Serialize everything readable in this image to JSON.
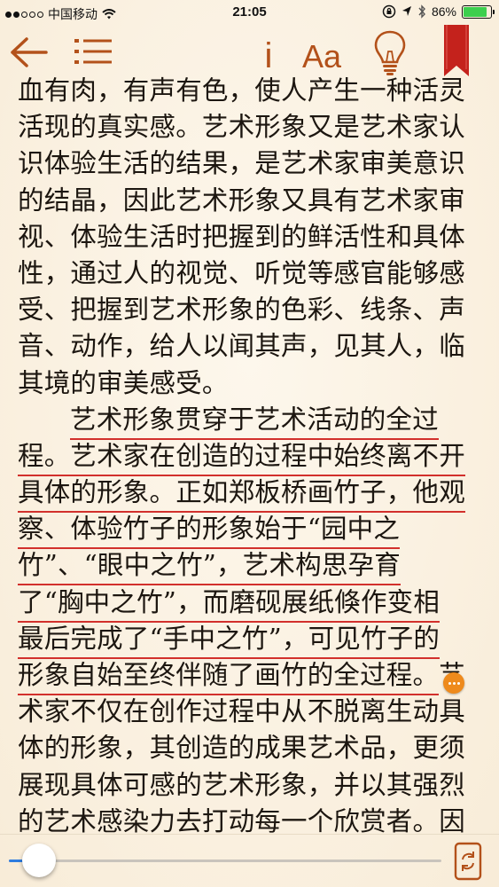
{
  "status_bar": {
    "carrier": "中国移动",
    "time": "21:05",
    "battery_text": "86%",
    "battery_level": 0.86,
    "icons": [
      "signal-icon",
      "wifi-icon",
      "rotation-lock-icon",
      "location-icon",
      "bluetooth-icon",
      "battery-icon"
    ]
  },
  "toolbar": {
    "icons": [
      "back-arrow-icon",
      "table-of-contents-icon",
      "info-icon",
      "font-size-icon",
      "lightbulb-icon",
      "bookmark-icon"
    ],
    "info_label": "i",
    "font_label": "Aa"
  },
  "colors": {
    "accent": "#b3511a",
    "bookmark": "#c4221c",
    "underline": "#d2302c",
    "page_bg": "#fbf3e4",
    "note_marker": "#ee8a1c",
    "slider_fill": "#2f7de0"
  },
  "content": {
    "p1": [
      "血有肉，有声有色，使人产生一种活灵",
      "活现的真实感。艺术形象又是艺术家认",
      "识体验生活的结果，是艺术家审美意识",
      "的结晶，因此艺术形象又具有艺术家审",
      "视、体验生活时把握到的鲜活性和具体",
      "性，通过人的视觉、听觉等感官能够感",
      "受、把握到艺术形象的色彩、线条、声",
      "音、动作，给人以闻其声，见其人，临",
      "其境的审美感受。"
    ],
    "p2_underlined": [
      "艺术形象贯穿于艺术活动的全过",
      "程。艺术家在创造的过程中始终离不开",
      "具体的形象。正如郑板桥画竹子，他观",
      "察、体验竹子的形象始于“园中之",
      "竹”、“眼中之竹”，艺术构思孕育",
      "了“胸中之竹”，而磨砚展纸倏作变相",
      "最后完成了“手中之竹”，可见竹子的",
      "形象自始至终伴随了画竹的全过程。"
    ],
    "p2_rest_first": "艺",
    "p2_rest": [
      "术家不仅在创作过程中从不脱离生动具",
      "体的形象，其创造的成果艺术品，更须",
      "展现具体可感的艺术形象，并以其强烈",
      "的艺术感染力去打动每一个欣赏者。因"
    ]
  },
  "progress": {
    "value": 0.07
  }
}
